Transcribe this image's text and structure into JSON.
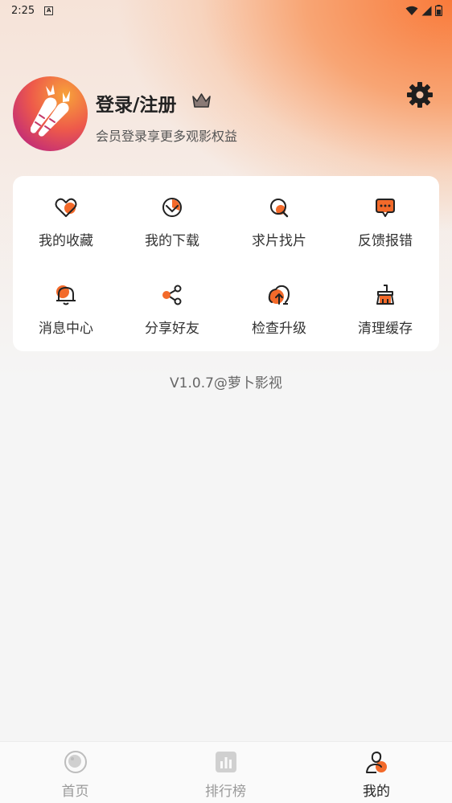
{
  "status_bar": {
    "time": "2:25",
    "notification_icon": "A"
  },
  "profile": {
    "title": "登录/注册",
    "subtitle": "会员登录享更多观影权益",
    "avatar_icon": "carrot-logo",
    "badge_icon": "crown-icon",
    "settings_icon": "gear-icon"
  },
  "grid": {
    "items": [
      {
        "label": "我的收藏",
        "icon": "heart-icon"
      },
      {
        "label": "我的下载",
        "icon": "download-icon"
      },
      {
        "label": "求片找片",
        "icon": "search-icon"
      },
      {
        "label": "反馈报错",
        "icon": "feedback-icon"
      },
      {
        "label": "消息中心",
        "icon": "bell-icon"
      },
      {
        "label": "分享好友",
        "icon": "share-icon"
      },
      {
        "label": "检查升级",
        "icon": "upgrade-icon"
      },
      {
        "label": "清理缓存",
        "icon": "broom-icon"
      }
    ]
  },
  "version": "V1.0.7@萝卜影视",
  "tabs": [
    {
      "label": "首页",
      "icon": "home-icon",
      "active": false
    },
    {
      "label": "排行榜",
      "icon": "ranking-icon",
      "active": false
    },
    {
      "label": "我的",
      "icon": "profile-icon",
      "active": true
    }
  ],
  "colors": {
    "accent": "#f36a2a",
    "tab_inactive": "#999999",
    "tab_active": "#222222"
  }
}
